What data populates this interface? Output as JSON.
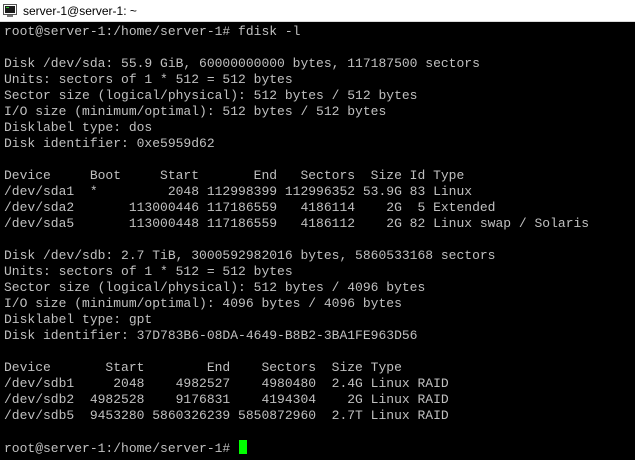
{
  "window": {
    "title": "server-1@server-1: ~",
    "icon": "putty-terminal-icon"
  },
  "terminal": {
    "text_color": "#c0c0c0",
    "background": "#000000",
    "cursor_color": "#00ff00",
    "lines": [
      "root@server-1:/home/server-1# fdisk -l",
      "",
      "Disk /dev/sda: 55.9 GiB, 60000000000 bytes, 117187500 sectors",
      "Units: sectors of 1 * 512 = 512 bytes",
      "Sector size (logical/physical): 512 bytes / 512 bytes",
      "I/O size (minimum/optimal): 512 bytes / 512 bytes",
      "Disklabel type: dos",
      "Disk identifier: 0xe5959d62",
      "",
      "Device     Boot     Start       End   Sectors  Size Id Type",
      "/dev/sda1  *         2048 112998399 112996352 53.9G 83 Linux",
      "/dev/sda2       113000446 117186559   4186114    2G  5 Extended",
      "/dev/sda5       113000448 117186559   4186112    2G 82 Linux swap / Solaris",
      "",
      "Disk /dev/sdb: 2.7 TiB, 3000592982016 bytes, 5860533168 sectors",
      "Units: sectors of 1 * 512 = 512 bytes",
      "Sector size (logical/physical): 512 bytes / 4096 bytes",
      "I/O size (minimum/optimal): 4096 bytes / 4096 bytes",
      "Disklabel type: gpt",
      "Disk identifier: 37D783B6-08DA-4649-B8B2-3BA1FE963D56",
      "",
      "Device       Start        End    Sectors  Size Type",
      "/dev/sdb1     2048    4982527    4980480  2.4G Linux RAID",
      "/dev/sdb2  4982528    9176831    4194304    2G Linux RAID",
      "/dev/sdb5  9453280 5860326239 5850872960  2.7T Linux RAID",
      ""
    ],
    "prompt": "root@server-1:/home/server-1# "
  }
}
